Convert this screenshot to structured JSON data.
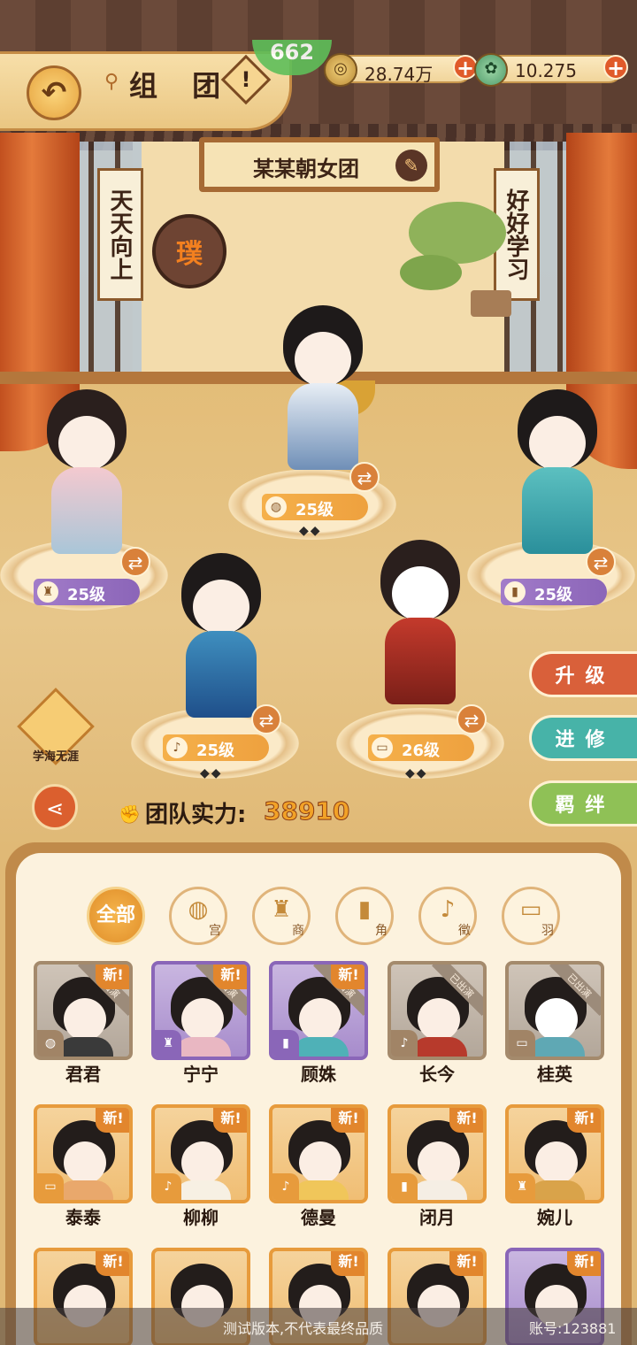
{
  "header": {
    "title": "组 团",
    "help_symbol": "!",
    "timer_text": "662",
    "resources": [
      {
        "icon": "coin-icon",
        "value": "28.74万"
      },
      {
        "icon": "jade-icon",
        "value": "10.275"
      }
    ]
  },
  "team": {
    "name": "某某朝女团",
    "scroll_left": "天天向上",
    "scroll_right": "好好学习",
    "seal_char": "璞"
  },
  "stage_members": [
    {
      "level": "25级",
      "badge": "orange"
    },
    {
      "level": "25级",
      "badge": "purple"
    },
    {
      "level": "25级",
      "badge": "purple"
    },
    {
      "level": "25级",
      "badge": "orange"
    },
    {
      "level": "26级",
      "badge": "orange"
    }
  ],
  "side_buttons": {
    "upgrade": "升级",
    "advance": "进修",
    "bond": "羁绊"
  },
  "xuehai_label": "学海无涯",
  "team_power": {
    "label": "团队实力:",
    "value": "38910"
  },
  "filters": [
    {
      "label": "全部",
      "active": true
    },
    {
      "label": "宫",
      "icon": "drum-icon"
    },
    {
      "label": "商",
      "icon": "bell-icon"
    },
    {
      "label": "角",
      "icon": "clapper-icon"
    },
    {
      "label": "徵",
      "icon": "pipa-icon"
    },
    {
      "label": "羽",
      "icon": "flute-icon"
    }
  ],
  "roster": [
    {
      "name": "君君",
      "frame": "gray",
      "new": "新!",
      "played": "已出演"
    },
    {
      "name": "宁宁",
      "frame": "purple",
      "new": "新!",
      "played": "已出演"
    },
    {
      "name": "顾姝",
      "frame": "purple",
      "new": "新!",
      "played": "已出演"
    },
    {
      "name": "长今",
      "frame": "gray",
      "new": "",
      "played": "已出演"
    },
    {
      "name": "桂英",
      "frame": "gray",
      "new": "",
      "played": "已出演"
    },
    {
      "name": "泰泰",
      "frame": "orange",
      "new": "新!",
      "played": ""
    },
    {
      "name": "柳柳",
      "frame": "orange",
      "new": "新!",
      "played": ""
    },
    {
      "name": "德曼",
      "frame": "orange",
      "new": "新!",
      "played": ""
    },
    {
      "name": "闭月",
      "frame": "orange",
      "new": "新!",
      "played": ""
    },
    {
      "name": "婉儿",
      "frame": "orange",
      "new": "新!",
      "played": ""
    },
    {
      "name": "",
      "frame": "orange",
      "new": "新!",
      "played": ""
    },
    {
      "name": "",
      "frame": "orange",
      "new": "",
      "played": ""
    },
    {
      "name": "",
      "frame": "orange",
      "new": "新!",
      "played": ""
    },
    {
      "name": "",
      "frame": "orange",
      "new": "新!",
      "played": ""
    },
    {
      "name": "",
      "frame": "purple",
      "new": "新!",
      "played": ""
    }
  ],
  "footer": {
    "notice": "测试版本,不代表最终品质",
    "account": "账号:123881"
  },
  "colors": {
    "accent_orange": "#e08e29",
    "upgrade_red": "#d9603a",
    "advance_teal": "#47b3a8",
    "bond_green": "#8fc156"
  }
}
